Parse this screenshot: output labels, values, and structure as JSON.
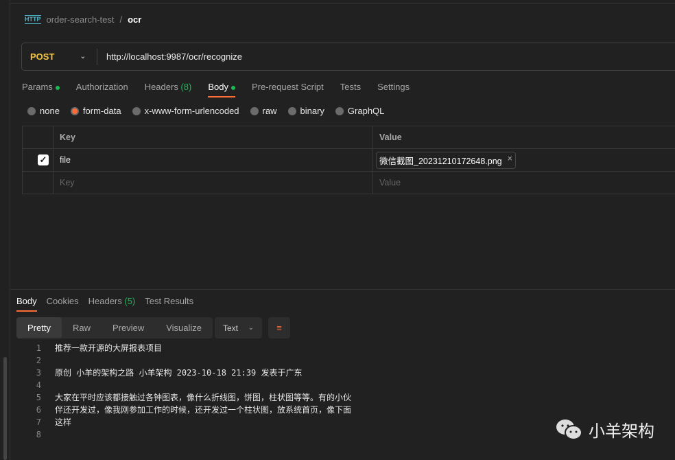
{
  "breadcrumb": {
    "collection": "order-search-test",
    "separator": "/",
    "request": "ocr",
    "icon": "HTTP"
  },
  "request": {
    "method": "POST",
    "url": "http://localhost:9987/ocr/recognize"
  },
  "req_tabs": [
    {
      "label": "Params"
    },
    {
      "label": "Authorization"
    },
    {
      "label": "Headers",
      "count": "(8)"
    },
    {
      "label": "Body"
    },
    {
      "label": "Pre-request Script"
    },
    {
      "label": "Tests"
    },
    {
      "label": "Settings"
    }
  ],
  "body_types": [
    "none",
    "form-data",
    "x-www-form-urlencoded",
    "raw",
    "binary",
    "GraphQL"
  ],
  "selected_body_type": "form-data",
  "table": {
    "headers": [
      "Key",
      "Value"
    ],
    "rows": [
      {
        "key": "file",
        "value": "微信截图_20231210172648.png",
        "checked": true
      }
    ],
    "placeholder": {
      "key": "Key",
      "value": "Value"
    }
  },
  "resp_tabs": [
    {
      "label": "Body"
    },
    {
      "label": "Cookies"
    },
    {
      "label": "Headers",
      "count": "(5)"
    },
    {
      "label": "Test Results"
    }
  ],
  "view_modes": [
    "Pretty",
    "Raw",
    "Preview",
    "Visualize"
  ],
  "format": "Text",
  "lines": [
    "推荐一款开源的大屏报表项目",
    "",
    "原创 小羊的架构之路 小羊架构 2023-10-18 21:39 发表于广东",
    "",
    "大家在平时应该都接触过各钟图表，像什么折线图，饼图，柱状图等等。有的小伙",
    "伴还开发过，像我刚参加工作的时候，还开发过一个柱状图，放系统首页，像下面",
    "这样",
    ""
  ],
  "watermark": "小羊架构",
  "colors": {
    "accent": "#ff6c37",
    "method": "#f5c542",
    "success": "#1db954"
  }
}
